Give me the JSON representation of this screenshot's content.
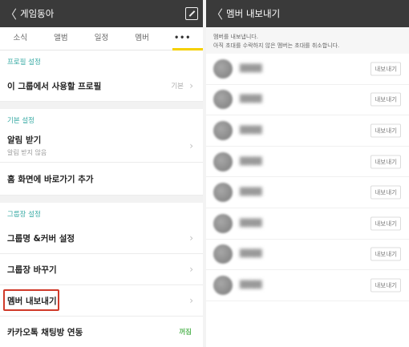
{
  "left": {
    "header": {
      "back": "〈",
      "title": "게임동아"
    },
    "tabs": [
      "소식",
      "앨범",
      "일정",
      "멤버",
      "•••"
    ],
    "profile_section": {
      "title": "프로필 설정",
      "rows": [
        {
          "label": "이 그룹에서 사용할 프로필",
          "value": "기본"
        }
      ]
    },
    "basic_section": {
      "title": "기본 설정",
      "rows": [
        {
          "label": "알림 받기",
          "sub": "알림 받지 않음"
        },
        {
          "label": "홈 화면에 바로가기 추가"
        }
      ]
    },
    "leader_section": {
      "title": "그룹장 설정",
      "rows": [
        {
          "label": "그룹명 &커버 설정"
        },
        {
          "label": "그룹장 바꾸기"
        },
        {
          "label": "멤버 내보내기"
        },
        {
          "label": "카카오톡 채팅방 연동",
          "value": "꺼짐"
        }
      ]
    }
  },
  "right": {
    "header": {
      "back": "〈",
      "title": "멤버 내보내기"
    },
    "notice": {
      "line1": "멤버를 내보냅니다.",
      "line2": "아직 초대를 수락하지 않은 멤버는 초대를 취소합니다."
    },
    "members": [
      {
        "name": "████",
        "button": "내보내기"
      },
      {
        "name": "████",
        "button": "내보내기"
      },
      {
        "name": "████",
        "button": "내보내기"
      },
      {
        "name": "████",
        "button": "내보내기"
      },
      {
        "name": "████",
        "button": "내보내기"
      },
      {
        "name": "████",
        "button": "내보내기"
      },
      {
        "name": "████",
        "button": "내보내기"
      },
      {
        "name": "████",
        "button": "내보내기"
      }
    ]
  },
  "colors": {
    "header_bg": "#3a3a3a",
    "section_title": "#35a9a3",
    "tab_indicator": "#f5d000",
    "highlight_border": "#d03a2a",
    "toggle_off": "#5cb85c"
  }
}
